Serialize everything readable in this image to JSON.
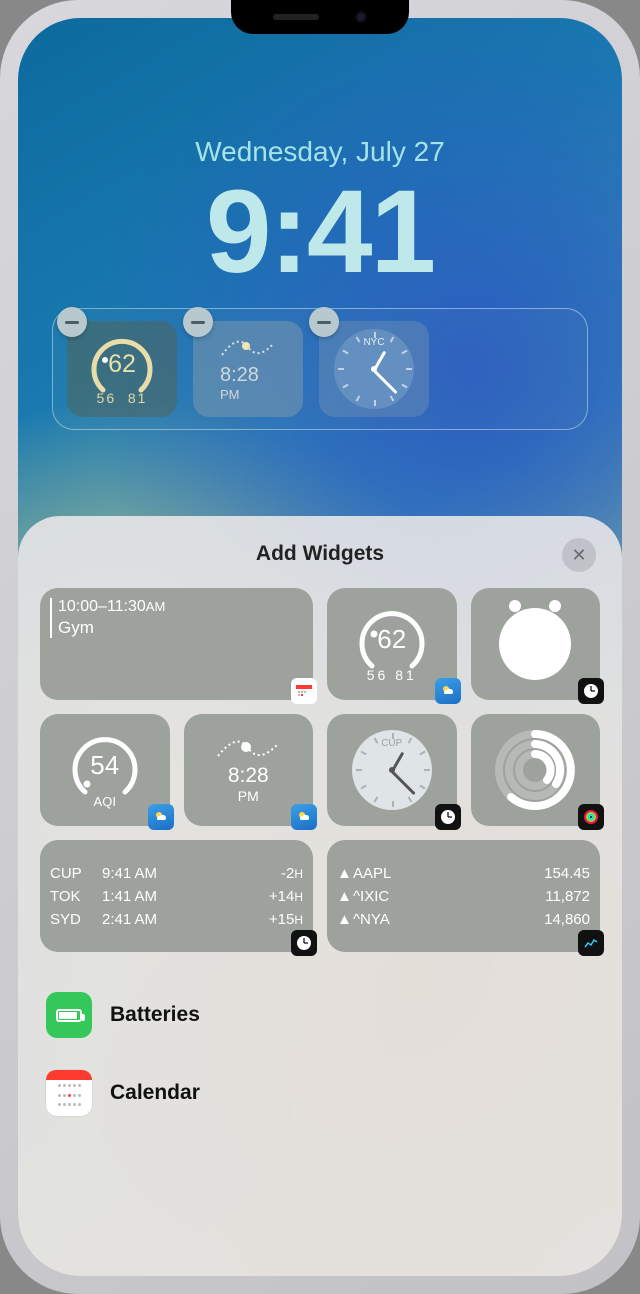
{
  "lock": {
    "date": "Wednesday, July 27",
    "time": "9:41"
  },
  "tray_widgets": {
    "temp": {
      "current": "62",
      "low": "56",
      "high": "81"
    },
    "sunset": {
      "time": "8:28",
      "period": "PM"
    },
    "clock": {
      "city": "NYC"
    }
  },
  "sheet": {
    "title": "Add Widgets",
    "close_glyph": "✕",
    "calendar": {
      "time_range": "10:00–11:30",
      "ampm": "AM",
      "event": "Gym"
    },
    "weather_gauge": {
      "current": "62",
      "low": "56",
      "high": "81"
    },
    "aqi": {
      "value": "54",
      "label": "AQI"
    },
    "sunset": {
      "time": "8:28",
      "period": "PM"
    },
    "analog": {
      "city": "CUP"
    },
    "world_clock": [
      {
        "city": "CUP",
        "time": "9:41 AM",
        "offset": "-2",
        "unit": "H"
      },
      {
        "city": "TOK",
        "time": "1:41 AM",
        "offset": "+14",
        "unit": "H"
      },
      {
        "city": "SYD",
        "time": "2:41 AM",
        "offset": "+15",
        "unit": "H"
      }
    ],
    "stocks": [
      {
        "arrow": "▲",
        "symbol": "AAPL",
        "value": "154.45"
      },
      {
        "arrow": "▲",
        "symbol": "^IXIC",
        "value": "11,872"
      },
      {
        "arrow": "▲",
        "symbol": "^NYA",
        "value": "14,860"
      }
    ],
    "apps": {
      "batteries": "Batteries",
      "calendar": "Calendar"
    }
  }
}
